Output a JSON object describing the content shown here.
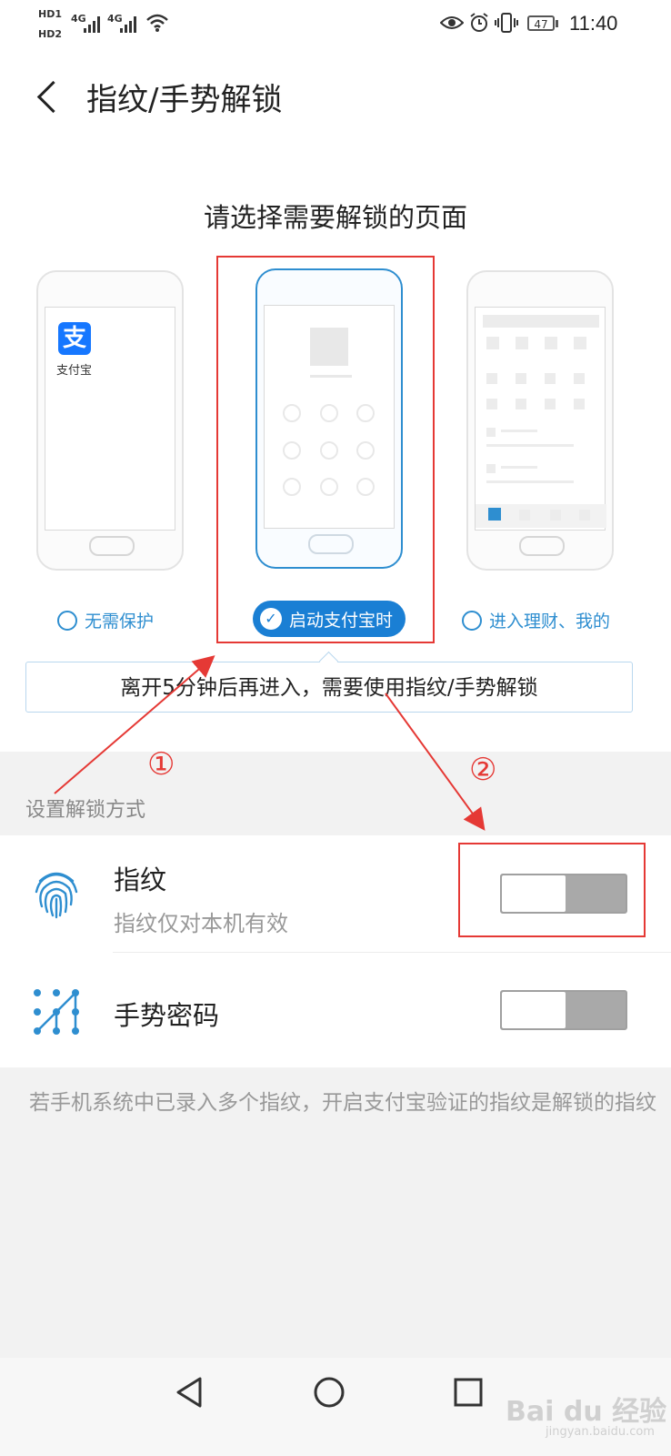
{
  "status_bar": {
    "hd1": "HD1",
    "hd2": "HD2",
    "net1": "4G",
    "net2": "4G",
    "battery": "47",
    "time": "11:40"
  },
  "header": {
    "title": "指纹/手势解锁",
    "back_icon": "chevron-left-icon"
  },
  "page_selector": {
    "heading": "请选择需要解锁的页面",
    "app_name": "支付宝",
    "app_logo_char": "支",
    "options": [
      {
        "label": "无需保护",
        "selected": false
      },
      {
        "label": "启动支付宝时",
        "selected": true
      },
      {
        "label": "进入理财、我的",
        "selected": false
      }
    ],
    "tooltip": "离开5分钟后再进入，需要使用指纹/手势解锁"
  },
  "unlock_methods": {
    "section_label": "设置解锁方式",
    "items": [
      {
        "title": "指纹",
        "subtitle": "指纹仅对本机有效",
        "icon": "fingerprint-icon",
        "enabled": false
      },
      {
        "title": "手势密码",
        "subtitle": "",
        "icon": "gesture-pattern-icon",
        "enabled": false
      }
    ],
    "footnote": "若手机系统中已录入多个指纹，开启支付宝验证的指纹是解锁的指纹"
  },
  "annotations": {
    "num1": "①",
    "num2": "②"
  },
  "watermark": {
    "text": "Bai du 经验",
    "sub": "jingyan.baidu.com"
  },
  "nav_bar": {
    "back": "triangle-back-icon",
    "home": "circle-home-icon",
    "recents": "square-recents-icon"
  },
  "colors": {
    "accent": "#1a7fd4",
    "annotation": "#e53935",
    "toggle_off": "#a9a9a9"
  }
}
